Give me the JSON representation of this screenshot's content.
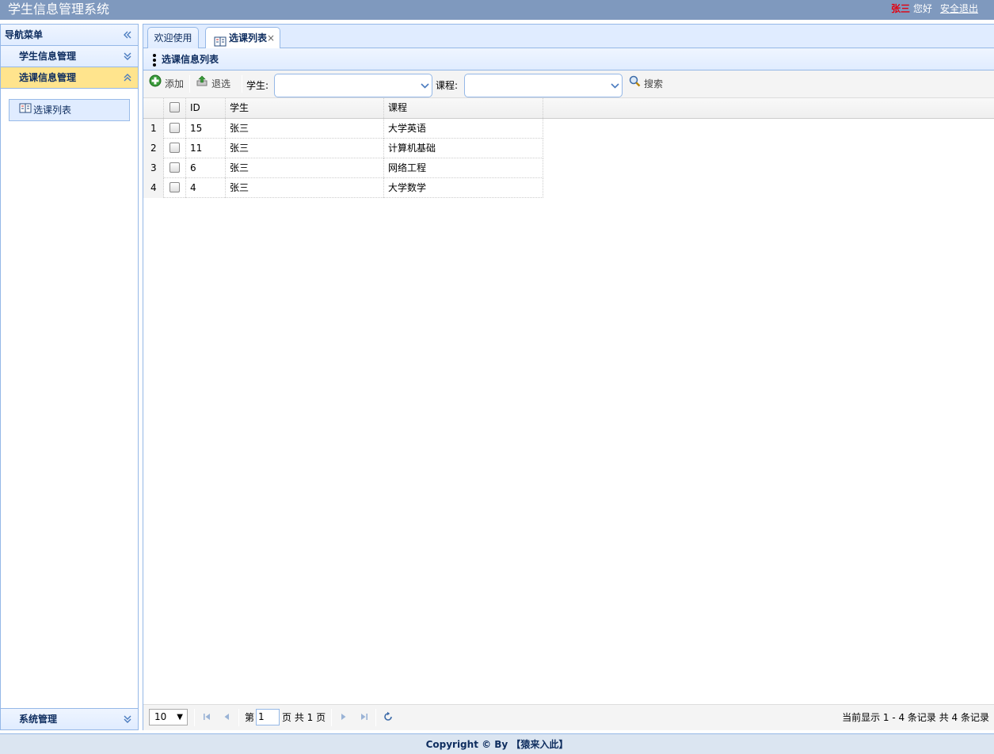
{
  "header": {
    "title": "学生信息管理系统",
    "user_name": "张三",
    "greeting": "您好",
    "logout_label": "安全退出"
  },
  "sidebar": {
    "title": "导航菜单",
    "collapse_icon": "double-chevron-left-icon",
    "sections": [
      {
        "label": "学生信息管理",
        "expanded": false
      },
      {
        "label": "选课信息管理",
        "expanded": true
      },
      {
        "label": "系统管理",
        "expanded": false
      }
    ],
    "menu_item": {
      "label": "选课列表",
      "icon": "book-icon"
    }
  },
  "tabs": [
    {
      "label": "欢迎使用",
      "active": false
    },
    {
      "label": "选课列表",
      "active": true,
      "closable": true,
      "close_glyph": "×"
    }
  ],
  "list_title": "选课信息列表",
  "toolbar": {
    "add_label": "添加",
    "drop_label": "退选",
    "student_label": "学生:",
    "student_value": "",
    "course_label": "课程:",
    "course_value": "",
    "search_label": "搜索"
  },
  "grid": {
    "columns": [
      "ID",
      "学生",
      "课程"
    ],
    "rows": [
      {
        "num": "1",
        "id": "15",
        "student": "张三",
        "course": "大学英语"
      },
      {
        "num": "2",
        "id": "11",
        "student": "张三",
        "course": "计算机基础"
      },
      {
        "num": "3",
        "id": "6",
        "student": "张三",
        "course": "网络工程"
      },
      {
        "num": "4",
        "id": "4",
        "student": "张三",
        "course": "大学数学"
      }
    ]
  },
  "pager": {
    "page_size": "10",
    "page_prefix": "第",
    "current_page": "1",
    "page_suffix": "页 共 1 页",
    "info": "当前显示 1 - 4 条记录 共 4 条记录"
  },
  "footer": "Copyright © By 【猿来入此】",
  "colors": {
    "header_bg": "#7f99be",
    "border": "#95b8e7",
    "selected_section": "#ffe48d",
    "user_name": "#e4000f"
  }
}
